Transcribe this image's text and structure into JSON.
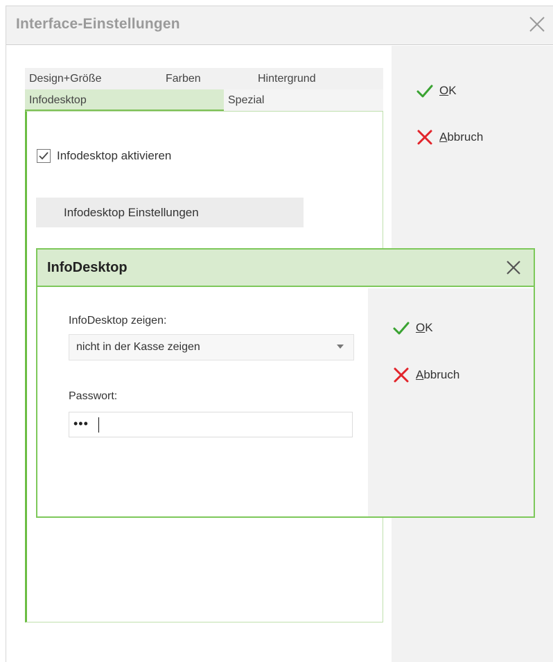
{
  "window": {
    "title": "Interface-Einstellungen",
    "ok_label": "OK",
    "cancel_label": "Abbruch"
  },
  "tabs": {
    "row1": [
      "Design+Größe",
      "Farben",
      "Hintergrund"
    ],
    "row2": [
      "Infodesktop",
      "Spezial"
    ],
    "active": "Infodesktop"
  },
  "panel": {
    "checkbox_label": "Infodesktop aktivieren",
    "checkbox_checked": true,
    "settings_button": "Infodesktop Einstellungen"
  },
  "dialog": {
    "title": "InfoDesktop",
    "show_label": "InfoDesktop zeigen:",
    "show_value": "nicht in der Kasse zeigen",
    "password_label": "Passwort:",
    "password_value": "•••",
    "ok_label": "OK",
    "cancel_label": "Abbruch"
  },
  "icons": {
    "ok": "check-icon",
    "cancel": "cross-icon",
    "close": "close-icon",
    "dropdown": "triangle-down-icon"
  },
  "colors": {
    "accent_green": "#6cbd44",
    "tab_active_bg": "#d9ebcf",
    "ok_green": "#3aa332",
    "cancel_red": "#e2242b"
  }
}
